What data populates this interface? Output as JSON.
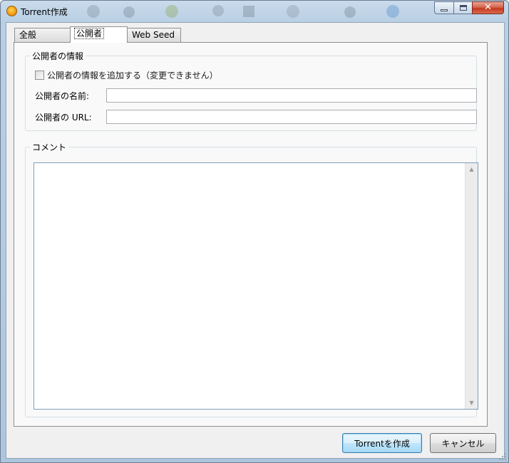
{
  "window": {
    "title": "Torrent作成",
    "close_glyph": "✕"
  },
  "tabs": [
    {
      "label": "全般"
    },
    {
      "label": "公開者",
      "active": true
    },
    {
      "label": "Web Seed"
    }
  ],
  "publisher_group": {
    "title": "公開者の情報",
    "add_info_checkbox": {
      "label": "公開者の情報を追加する（変更できません）",
      "checked": false
    },
    "name_label": "公開者の名前:",
    "name_value": "",
    "url_label": "公開者の URL:",
    "url_value": ""
  },
  "comment_group": {
    "title": "コメント",
    "value": ""
  },
  "buttons": {
    "create": "Torrentを作成",
    "cancel": "キャンセル"
  },
  "icons": {
    "app": "utorrent-logo-icon",
    "scroll_up": "▲",
    "scroll_down": "▼"
  }
}
